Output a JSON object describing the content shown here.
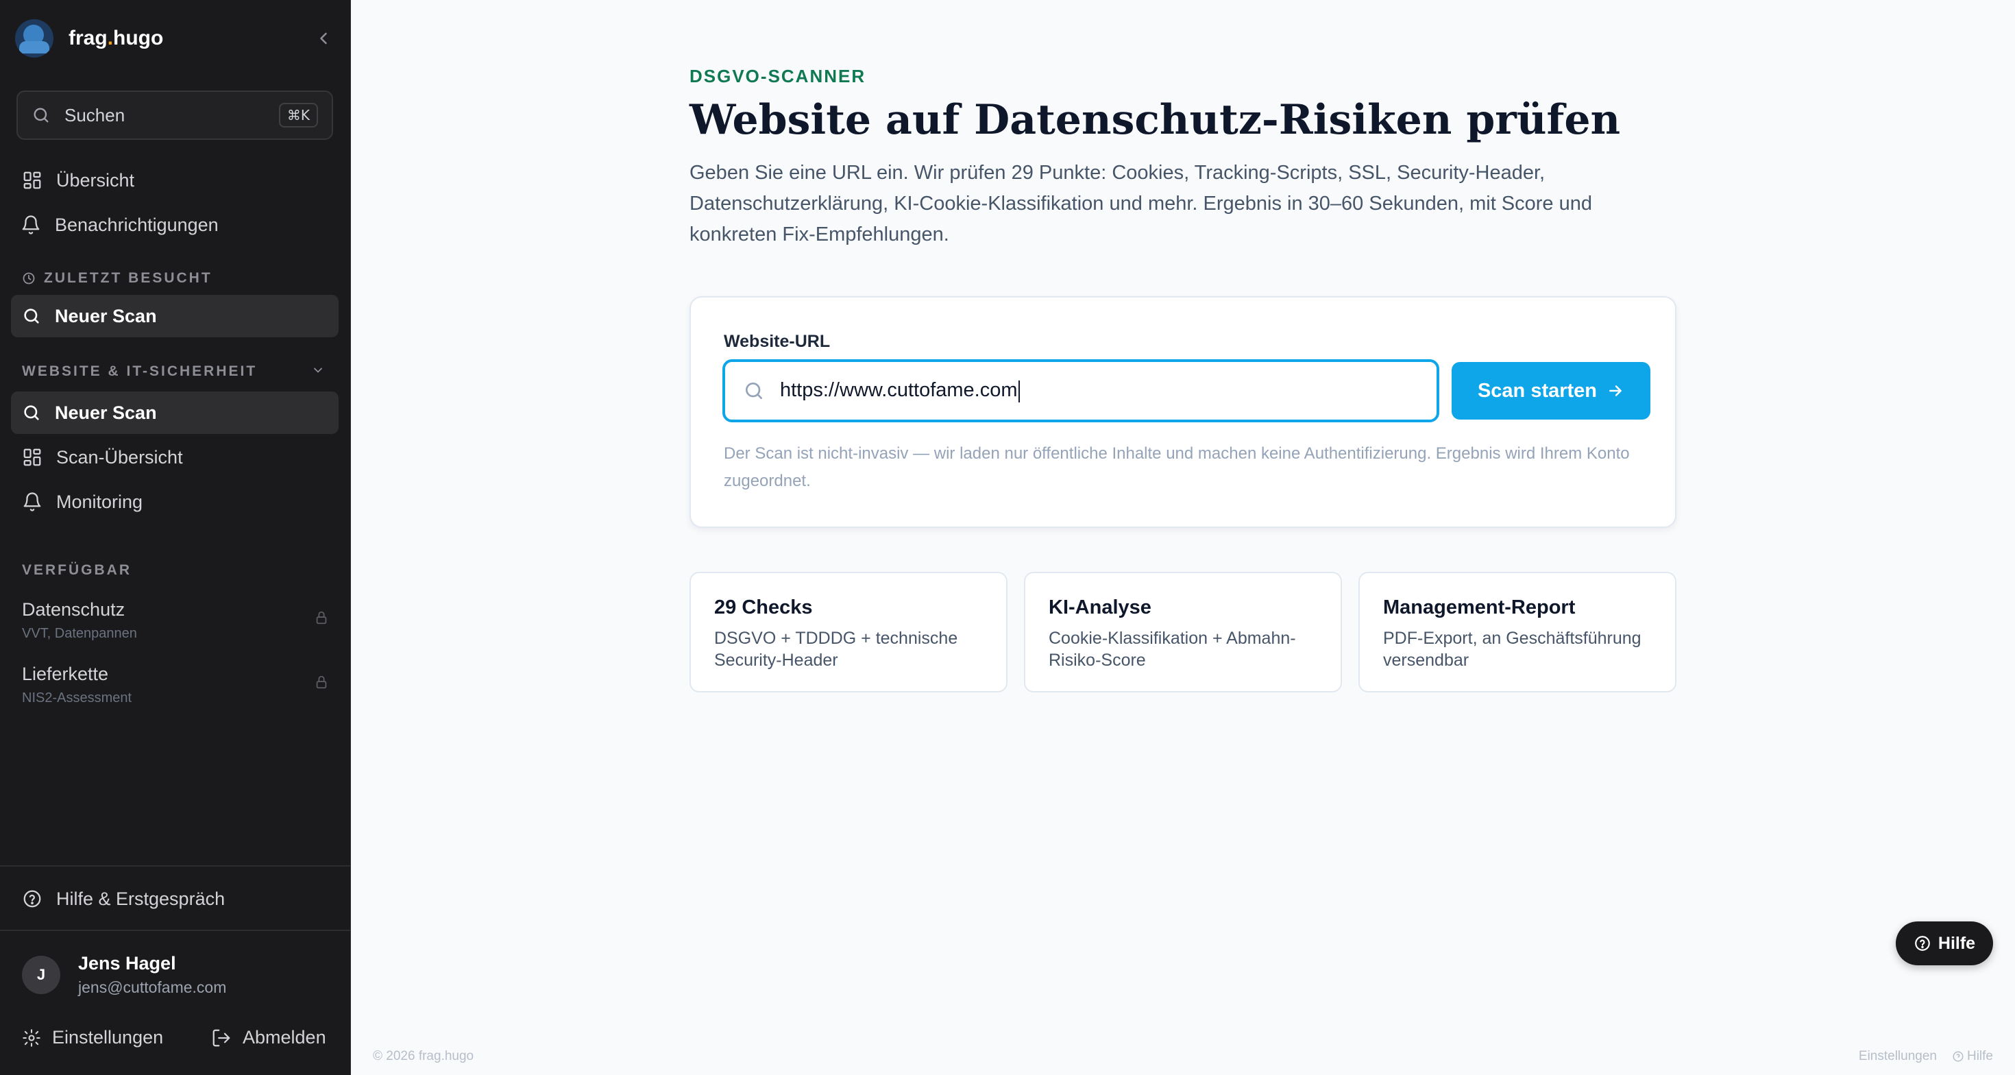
{
  "brand": {
    "name_pre": "frag",
    "name_dot": ".",
    "name_post": "hugo"
  },
  "sidebar": {
    "search": {
      "label": "Suchen",
      "shortcut": "⌘K"
    },
    "top_items": [
      {
        "label": "Übersicht",
        "icon": "grid-icon"
      },
      {
        "label": "Benachrichtigungen",
        "icon": "bell-icon"
      }
    ],
    "recent": {
      "heading": "ZULETZT BESUCHT",
      "items": [
        {
          "label": "Neuer Scan",
          "icon": "search-icon"
        }
      ]
    },
    "website": {
      "heading": "WEBSITE & IT-SICHERHEIT",
      "items": [
        {
          "label": "Neuer Scan",
          "icon": "search-icon"
        },
        {
          "label": "Scan-Übersicht",
          "icon": "grid-icon"
        },
        {
          "label": "Monitoring",
          "icon": "bell-icon"
        }
      ]
    },
    "available": {
      "heading": "VERFÜGBAR",
      "items": [
        {
          "title": "Datenschutz",
          "subtitle": "VVT, Datenpannen",
          "icon": "lock-icon"
        },
        {
          "title": "Lieferkette",
          "subtitle": "NIS2-Assessment",
          "icon": "lock-icon"
        }
      ]
    },
    "help": "Hilfe & Erstgespräch",
    "user": {
      "initial": "J",
      "name": "Jens Hagel",
      "email": "jens@cuttofame.com"
    },
    "settings": "Einstellungen",
    "logout": "Abmelden"
  },
  "main": {
    "eyebrow": "DSGVO-SCANNER",
    "title": "Website auf Datenschutz-Risiken prüfen",
    "lead": "Geben Sie eine URL ein. Wir prüfen 29 Punkte: Cookies, Tracking-Scripts, SSL, Security-Header, Datenschutzerklärung, KI-Cookie-Klassifikation und mehr. Ergebnis in 30–60 Sekunden, mit Score und konkreten Fix-Empfehlungen.",
    "form": {
      "label": "Website-URL",
      "value": "https://www.cuttofame.com",
      "button": "Scan starten",
      "hint": "Der Scan ist nicht-invasiv — wir laden nur öffentliche Inhalte und machen keine Authentifizierung. Ergebnis wird Ihrem Konto zugeordnet."
    },
    "features": [
      {
        "title": "29 Checks",
        "desc": "DSGVO + TDDDG + technische Security-Header"
      },
      {
        "title": "KI-Analyse",
        "desc": "Cookie-Klassifikation + Abmahn-Risiko-Score"
      },
      {
        "title": "Management-Report",
        "desc": "PDF-Export, an Geschäftsführung versendbar"
      }
    ]
  },
  "help_fab": "Hilfe",
  "footer": {
    "copyright": "© 2026 frag.hugo",
    "settings": "Einstellungen",
    "help": "Hilfe"
  },
  "colors": {
    "accent": "#0ea5e9",
    "eyebrow": "#0f7a52",
    "sidebar_bg": "#1a1a1c",
    "brand_dot": "#f59e0b"
  }
}
